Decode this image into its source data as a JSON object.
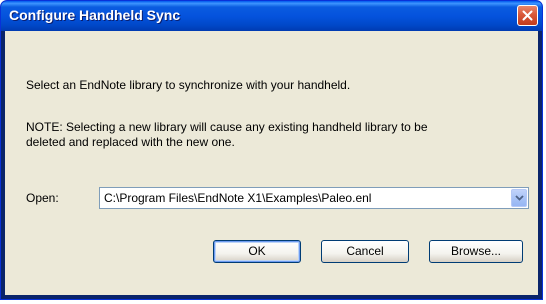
{
  "window": {
    "title": "Configure Handheld Sync"
  },
  "body": {
    "intro": "Select an EndNote library to synchronize with your handheld.",
    "note_line1": "NOTE:  Selecting a new library will cause any existing handheld library to be",
    "note_line2": "deleted and replaced with the new one."
  },
  "open": {
    "label": "Open:",
    "value": "C:\\Program Files\\EndNote X1\\Examples\\Paleo.enl"
  },
  "buttons": {
    "ok": "OK",
    "cancel": "Cancel",
    "browse": "Browse..."
  },
  "icons": {
    "close": "close-icon",
    "dropdown": "chevron-down-icon"
  },
  "colors": {
    "titlebar": "#0553dd",
    "close_button": "#d9583a",
    "client_background": "#ece9d8",
    "button_border": "#003c74"
  }
}
